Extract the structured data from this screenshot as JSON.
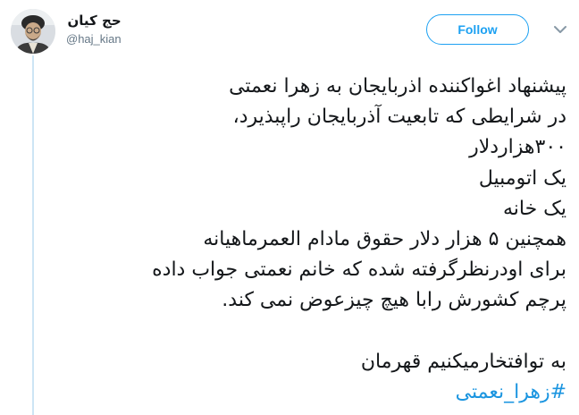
{
  "user": {
    "display_name": "حج کیان",
    "handle": "@haj_kian",
    "avatar_icon": "portrait-avatar"
  },
  "actions": {
    "follow_label": "Follow",
    "more_icon": "chevron-down-icon"
  },
  "tweet": {
    "lines": [
      "پیشنهاد اغواکننده اذربایجان به زهرا نعمتی",
      "در شرایطی که تابعیت آذربایجان راپبذیرد،",
      "۳۰۰هزاردلار",
      "یک اتومبیل",
      "یک خانه",
      "همچنین ۵ هزار دلار حقوق مادام العمرماهیانه",
      "برای اودرنظرگرفته شده که خانم نعمتی جواب داده",
      "پرچم کشورش رابا هیچ چیزعوض نمی کند."
    ],
    "closing": "به توافتخارمیکنیم قهرمان",
    "hashtag": "#زهرا_نعمتی"
  },
  "colors": {
    "accent": "#1da1f2",
    "hashtag": "#1b95e0",
    "text": "#14171a",
    "muted": "#657786",
    "thread_line": "#cde5f5"
  }
}
